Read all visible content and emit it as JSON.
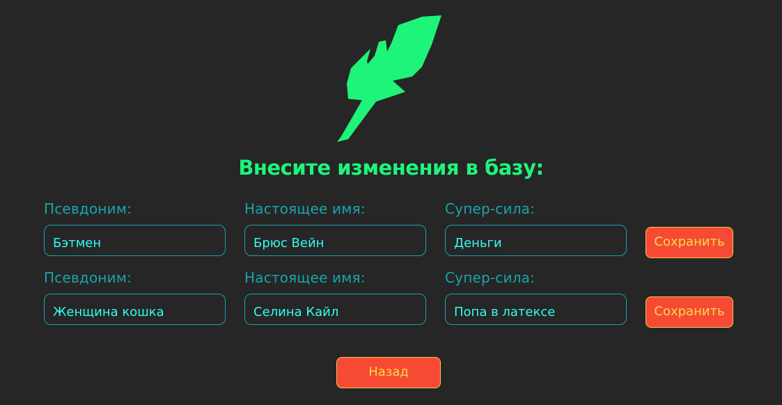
{
  "logo": {
    "icon": "feather-icon",
    "color": "#1ef47a"
  },
  "title": "Внесите изменения в базу:",
  "rows": [
    {
      "alias_label": "Псевдоним:",
      "alias_value": "Бэтмен",
      "name_label": "Настоящее имя:",
      "name_value": "Брюс Вейн",
      "power_label": "Супер-сила:",
      "power_value": "Деньги",
      "save_label": "Сохранить"
    },
    {
      "alias_label": "Псевдоним:",
      "alias_value": "Женщина кошка",
      "name_label": "Настоящее имя:",
      "name_value": "Селина Кайл",
      "power_label": "Супер-сила:",
      "power_value": "Попа в латексе",
      "save_label": "Сохранить"
    }
  ],
  "back_label": "Назад",
  "colors": {
    "background": "#262626",
    "accent_green": "#1ef47a",
    "label_teal": "#19a5ac",
    "value_cyan": "#33fbf2",
    "button_red": "#f74a35",
    "button_text": "#f8dc45"
  }
}
